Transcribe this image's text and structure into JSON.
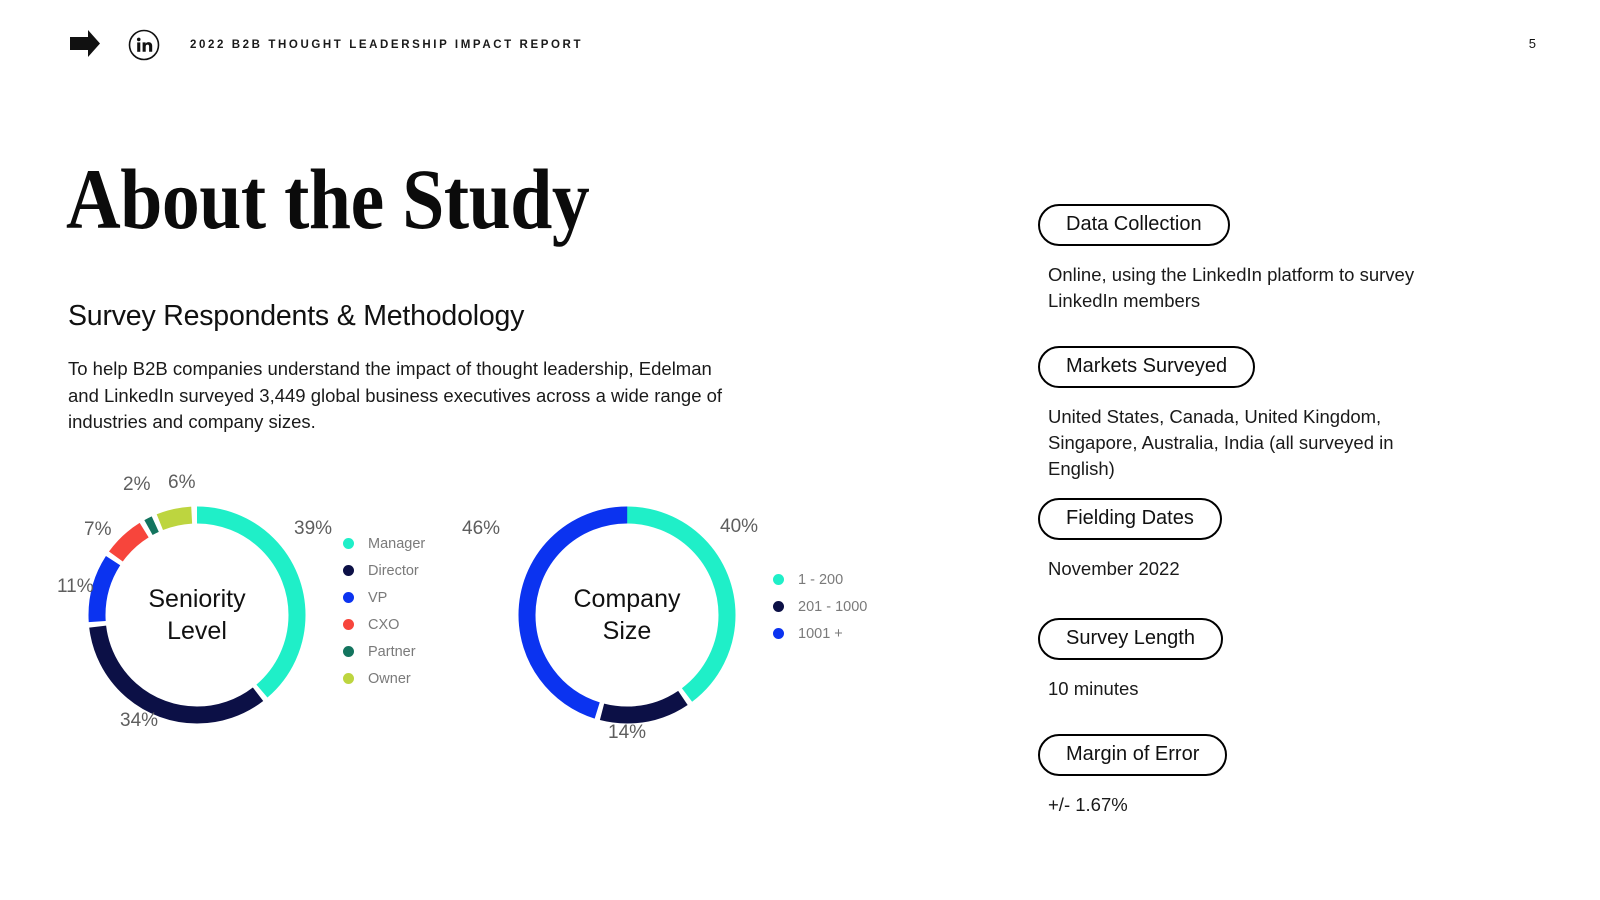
{
  "header": {
    "report_title": "2022 B2B THOUGHT LEADERSHIP IMPACT REPORT",
    "edelman_logo_name": "edelman-arrow-logo",
    "linkedin_logo_name": "linkedin-icon",
    "page_number": "5"
  },
  "main": {
    "title": "About the Study",
    "subheading": "Survey Respondents & Methodology",
    "intro_paragraph": "To help B2B companies understand the impact of thought leadership, Edelman and LinkedIn surveyed 3,449 global business executives across a wide range of industries and company sizes."
  },
  "chart_data": [
    {
      "type": "pie",
      "title": "Seniority Level",
      "center_line1": "Seniority",
      "center_line2": "Level",
      "categories": [
        "Manager",
        "Director",
        "VP",
        "CXO",
        "Partner",
        "Owner"
      ],
      "values": [
        39,
        34,
        11,
        7,
        2,
        6
      ],
      "labels": [
        "39%",
        "34%",
        "11%",
        "7%",
        "2%",
        "6%"
      ],
      "colors": [
        "#1FEFC8",
        "#0C1046",
        "#0B33F0",
        "#F7453C",
        "#13745E",
        "#BBD githubD"
      ],
      "legend_position": "right",
      "unit": "%"
    },
    {
      "type": "pie",
      "title": "Company Size",
      "center_line1": "Company",
      "center_line2": "Size",
      "categories": [
        "1 - 200",
        "201 - 1000",
        "1001 +"
      ],
      "values": [
        40,
        14,
        46
      ],
      "labels": [
        "40%",
        "14%",
        "46%"
      ],
      "colors": [
        "#1FEFC8",
        "#0C1046",
        "#0B33F0"
      ],
      "legend_position": "right",
      "unit": "%"
    }
  ],
  "seniority_chart": {
    "center_line1": "Seniority",
    "center_line2": "Level",
    "segments": [
      {
        "label": "Manager",
        "value": 39,
        "display": "39%",
        "color": "#1FEFC8"
      },
      {
        "label": "Director",
        "value": 34,
        "display": "34%",
        "color": "#0C1046"
      },
      {
        "label": "VP",
        "value": 11,
        "display": "11%",
        "color": "#0B33F0"
      },
      {
        "label": "CXO",
        "value": 7,
        "display": "7%",
        "color": "#F7453C"
      },
      {
        "label": "Partner",
        "value": 2,
        "display": "2%",
        "color": "#13745E"
      },
      {
        "label": "Owner",
        "value": 6,
        "display": "6%",
        "color": "#BDD53F"
      }
    ]
  },
  "company_chart": {
    "center_line1": "Company",
    "center_line2": "Size",
    "segments": [
      {
        "label": "1 - 200",
        "value": 40,
        "display": "40%",
        "color": "#1FEFC8"
      },
      {
        "label": "201 - 1000",
        "value": 14,
        "display": "14%",
        "color": "#0C1046"
      },
      {
        "label": "1001 +",
        "value": 46,
        "display": "46%",
        "color": "#0B33F0"
      }
    ]
  },
  "info_panel": {
    "items": [
      {
        "pill": "Data Collection",
        "text": "Online, using the LinkedIn platform to survey LinkedIn members"
      },
      {
        "pill": "Markets Surveyed",
        "text": "United States, Canada, United Kingdom, Singapore, Australia, India (all surveyed in English)"
      },
      {
        "pill": "Fielding Dates",
        "text": "November 2022"
      },
      {
        "pill": "Survey Length",
        "text": "10 minutes"
      },
      {
        "pill": "Margin of Error",
        "text": "+/- 1.67%"
      }
    ]
  },
  "colors": {
    "cyan": "#1FEFC8",
    "navy": "#0C1046",
    "blue": "#0B33F0",
    "red": "#F7453C",
    "teal": "#13745E",
    "lime": "#BDD53F",
    "text": "#111111",
    "muted": "#7a7a7a"
  }
}
